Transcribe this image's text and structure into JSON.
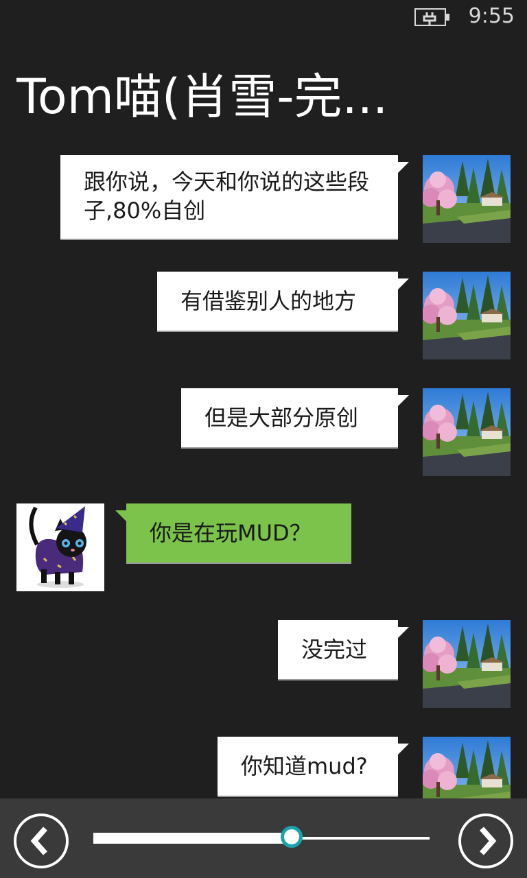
{
  "status": {
    "time": "9:55",
    "battery_icon": "battery-charging-icon"
  },
  "header": {
    "title": "Tom喵(肖雪-完..."
  },
  "messages": [
    {
      "side": "right",
      "text": "跟你说，今天和你说的这些段子,80%自创"
    },
    {
      "side": "right",
      "text": "有借鉴别人的地方"
    },
    {
      "side": "right",
      "text": "但是大部分原创"
    },
    {
      "side": "left",
      "text": "你是在玩MUD？"
    },
    {
      "side": "right",
      "text": "没完过"
    },
    {
      "side": "right",
      "text": "你知道mud?"
    }
  ],
  "avatars": {
    "self": "landscape-avatar",
    "contact": "black-cat-wizard-avatar"
  },
  "bubble_colors": {
    "outgoing": "#ffffff",
    "incoming": "#7bc34a"
  },
  "player": {
    "prev_icon": "chevron-left-icon",
    "next_icon": "chevron-right-icon",
    "progress": 0.59,
    "accent": "#1aa3a8"
  }
}
